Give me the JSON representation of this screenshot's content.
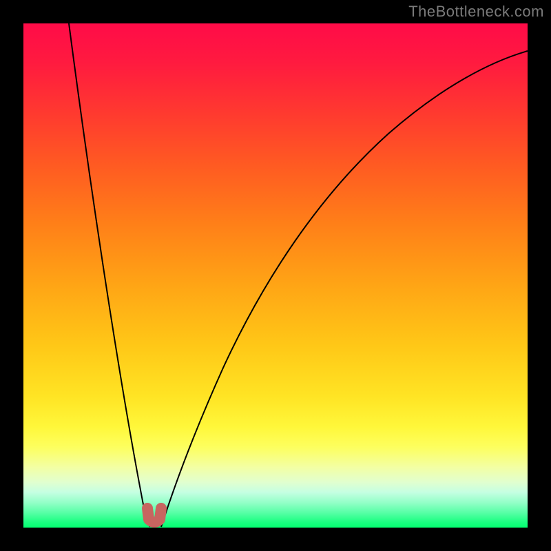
{
  "watermark": "TheBottleneck.com",
  "chart_data": {
    "type": "line",
    "title": "",
    "xlabel": "",
    "ylabel": "",
    "xlim": [
      0,
      100
    ],
    "ylim": [
      0,
      100
    ],
    "grid": false,
    "legend": false,
    "note": "Numeric values are estimated from pixel positions using the plot box as a 0–100 coordinate system (x left→right, y bottom→top). The figure has no visible ticks, axis labels, or numeric annotations.",
    "series": [
      {
        "name": "left-branch",
        "x": [
          9,
          12,
          15,
          18,
          21,
          24,
          25.1
        ],
        "y": [
          100,
          75,
          50,
          28,
          12,
          3,
          0.1
        ]
      },
      {
        "name": "right-branch",
        "x": [
          27.3,
          32,
          40,
          50,
          60,
          72,
          85,
          100
        ],
        "y": [
          0.1,
          10,
          32,
          50,
          63,
          75,
          85,
          94.5
        ]
      }
    ],
    "marker": {
      "name": "bottleneck-sweet-spot",
      "shape": "U",
      "color": "#c76560",
      "x_range": [
        24.6,
        27.3
      ],
      "y_range": [
        0.1,
        3.8
      ]
    },
    "background_gradient": {
      "direction": "top-to-bottom",
      "stops": [
        {
          "pos": 0.0,
          "color": "#ff0b48"
        },
        {
          "pos": 0.28,
          "color": "#ff5a22"
        },
        {
          "pos": 0.64,
          "color": "#ffc817"
        },
        {
          "pos": 0.84,
          "color": "#fdff5e"
        },
        {
          "pos": 0.97,
          "color": "#59ffa7"
        },
        {
          "pos": 1.0,
          "color": "#04ff71"
        }
      ]
    }
  }
}
